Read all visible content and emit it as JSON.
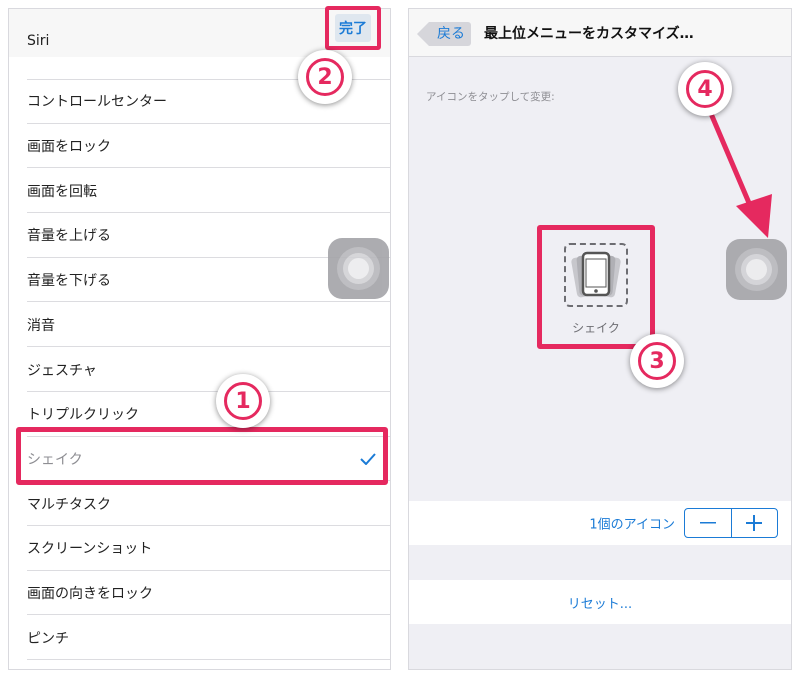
{
  "left": {
    "done_label": "完了",
    "items": [
      {
        "label": "Siri"
      },
      {
        "label": "コントロールセンター"
      },
      {
        "label": "画面をロック"
      },
      {
        "label": "画面を回転"
      },
      {
        "label": "音量を上げる"
      },
      {
        "label": "音量を下げる"
      },
      {
        "label": "消音"
      },
      {
        "label": "ジェスチャ"
      },
      {
        "label": "トリプルクリック"
      },
      {
        "label": "シェイク",
        "selected": true
      },
      {
        "label": "マルチタスク"
      },
      {
        "label": "スクリーンショット"
      },
      {
        "label": "画面の向きをロック"
      },
      {
        "label": "ピンチ"
      }
    ]
  },
  "right": {
    "back_label": "戻る",
    "title": "最上位メニューをカスタマイズ…",
    "hint": "アイコンをタップして変更:",
    "shake_label": "シェイク",
    "count_label": "1個のアイコン",
    "reset_label": "リセット..."
  },
  "callouts": {
    "c1": "1",
    "c2": "2",
    "c3": "3",
    "c4": "4"
  },
  "colors": {
    "accent": "#1b7bd6",
    "highlight": "#e5295f"
  }
}
